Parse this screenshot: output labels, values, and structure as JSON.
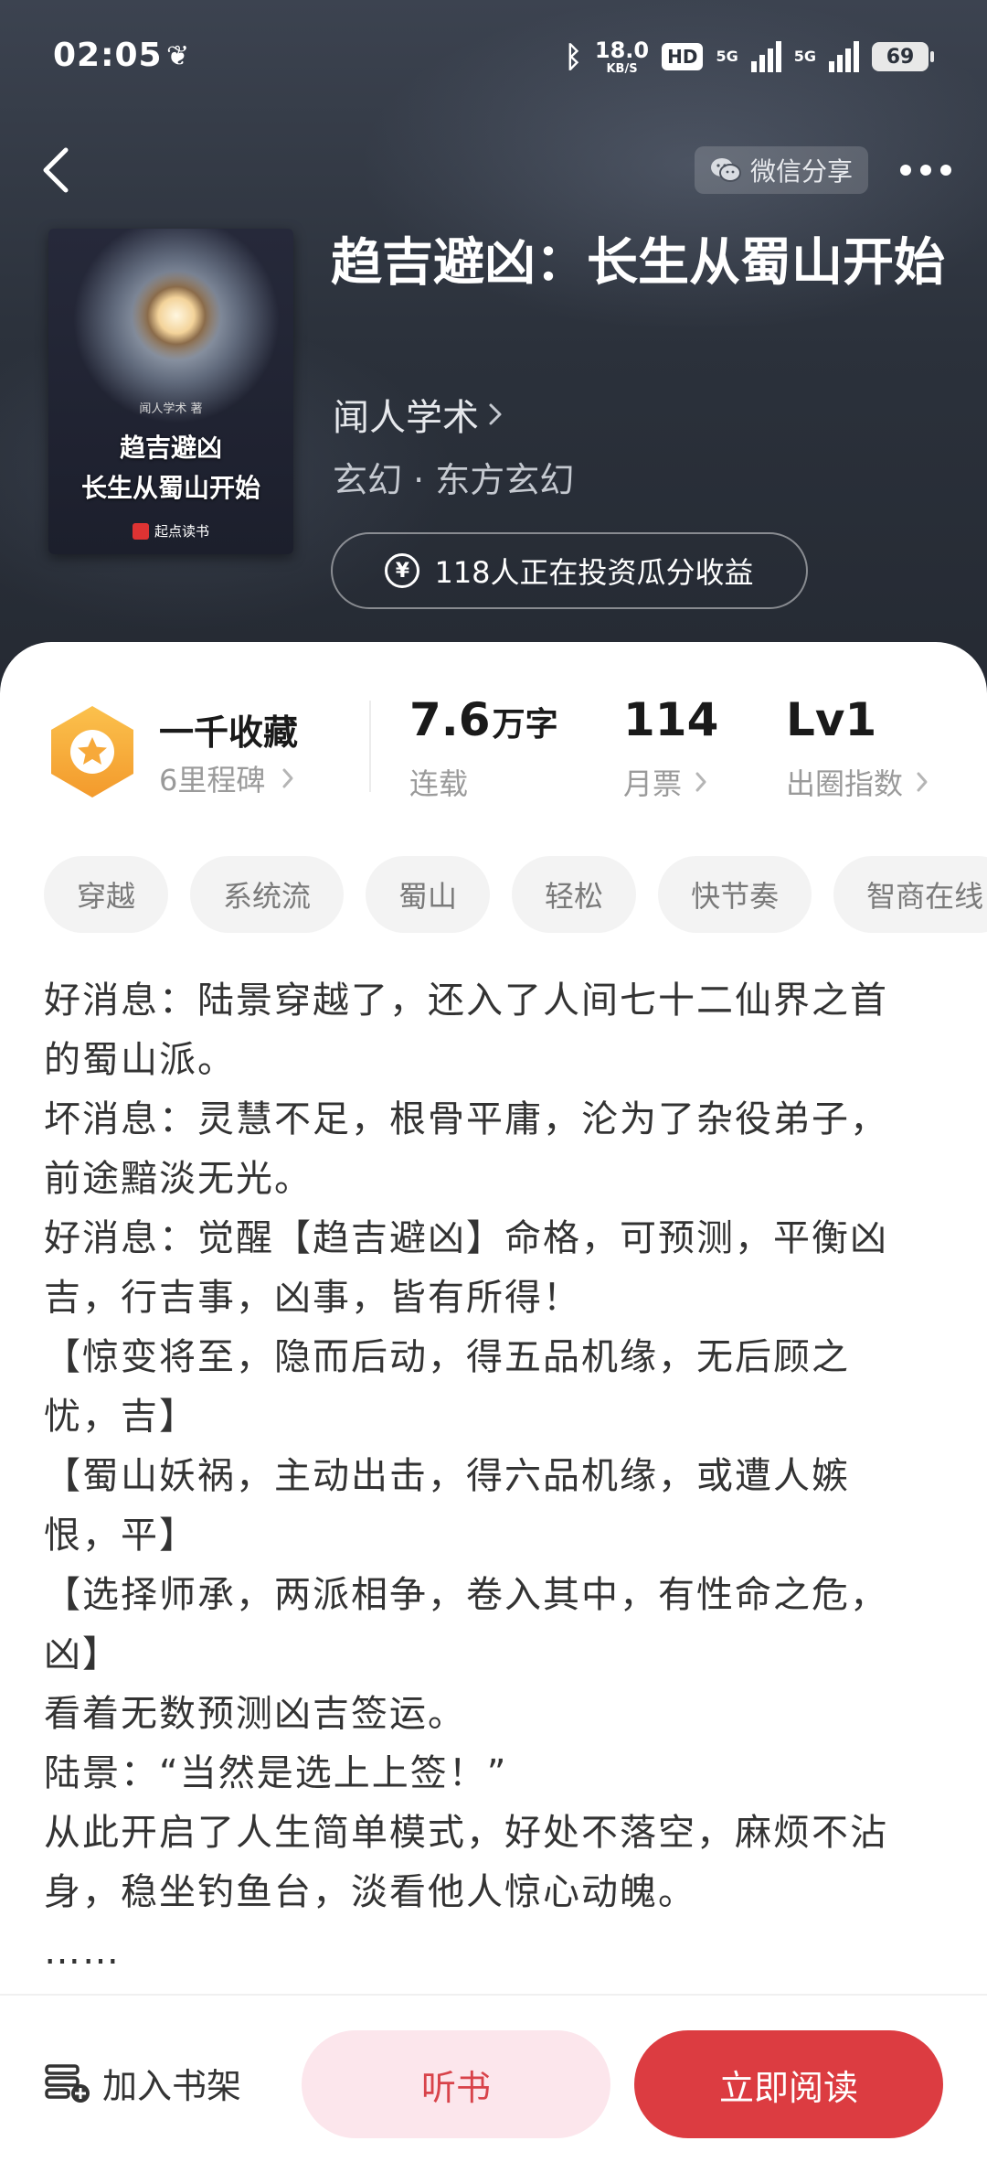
{
  "status_bar": {
    "time": "02:05",
    "net_speed_value": "18.0",
    "net_speed_unit": "KB/S",
    "hd_label": "HD",
    "sim1_label": "5G",
    "sim2_label": "5G",
    "battery": "69"
  },
  "header": {
    "share_label": "微信分享"
  },
  "cover": {
    "author_text": "闻人学术 著",
    "title_line1": "趋吉避凶",
    "title_line2": "长生从蜀山开始",
    "publisher": "起点读书"
  },
  "book": {
    "title": "趋吉避凶：长生从蜀山开始",
    "author": "闻人学术",
    "genre": "玄幻 · 东方玄幻",
    "invest_text": "118人正在投资瓜分收益"
  },
  "stats": {
    "milestone_title": "一千收藏",
    "milestone_sub": "6里程碑",
    "word_count_value": "7.6",
    "word_count_unit": "万字",
    "word_count_label": "连载",
    "monthly_votes_value": "114",
    "monthly_votes_label": "月票",
    "level_value": "Lv1",
    "level_label": "出圈指数"
  },
  "tags": [
    "穿越",
    "系统流",
    "蜀山",
    "轻松",
    "快节奏",
    "智商在线"
  ],
  "synopsis": [
    "好消息：陆景穿越了，还入了人间七十二仙界之首的蜀山派。",
    "坏消息：灵慧不足，根骨平庸，沦为了杂役弟子，前途黯淡无光。",
    "好消息：觉醒【趋吉避凶】命格，可预测，平衡凶吉，行吉事，凶事，皆有所得！",
    "【惊变将至，隐而后动，得五品机缘，无后顾之忧，吉】",
    "【蜀山妖祸，主动出击，得六品机缘，或遭人嫉恨，平】",
    "【选择师承，两派相争，卷入其中，有性命之危，凶】",
    "看着无数预测凶吉签运。",
    "陆景：“当然是选上上签！”",
    "从此开启了人生简单模式，好处不落空，麻烦不沾身，稳坐钓鱼台，淡看他人惊心动魄。",
    "……"
  ],
  "bottom_bar": {
    "shelf_label": "加入书架",
    "listen_label": "听书",
    "read_label": "立即阅读"
  },
  "colors": {
    "accent_red": "#dc3c41",
    "listen_bg": "#fce6ec",
    "badge_orange": "#f7a93a"
  }
}
